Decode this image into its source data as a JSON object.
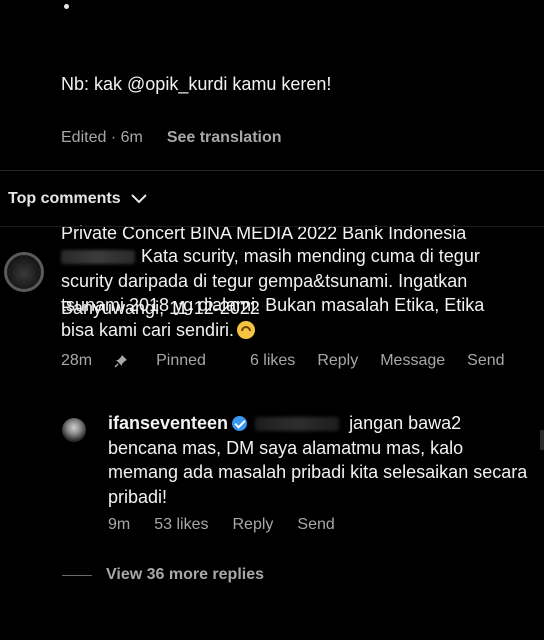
{
  "post": {
    "caption_line1": "Nb: kak @opik_kurdi kamu keren!",
    "caption_line2": "Private Concert BINA MEDIA 2022 Bank Indonesia",
    "caption_line3": "Banyuwangi, 11-12-2022",
    "edited": "Edited · 6m",
    "see_translation": "See translation"
  },
  "comments_header": {
    "label": "Top comments",
    "icon": "chevron-down-icon"
  },
  "comment1": {
    "text": "Kata scurity, masih mending cuma di tegur scurity daripada di tegur gempa&tsunami. Ingatkan tsunami 2018 yg dialami. Bukan masalah Etika, Etika bisa kami cari sendiri.",
    "emoji": "upside-down-face",
    "time": "28m",
    "pinned": "Pinned",
    "likes": "6 likes",
    "reply": "Reply",
    "message": "Message",
    "send": "Send"
  },
  "reply1": {
    "username": "ifanseventeen",
    "text": "jangan bawa2 bencana mas, DM saya alamatmu mas, kalo memang ada masalah pribadi kita selesaikan secara pribadi!",
    "time": "9m",
    "likes": "53 likes",
    "reply": "Reply",
    "send": "Send"
  },
  "view_more": "View 36 more replies",
  "colors": {
    "background": "#000000",
    "text": "#f2f2f2",
    "secondary": "#a8a8a8",
    "verified": "#3897f0"
  }
}
